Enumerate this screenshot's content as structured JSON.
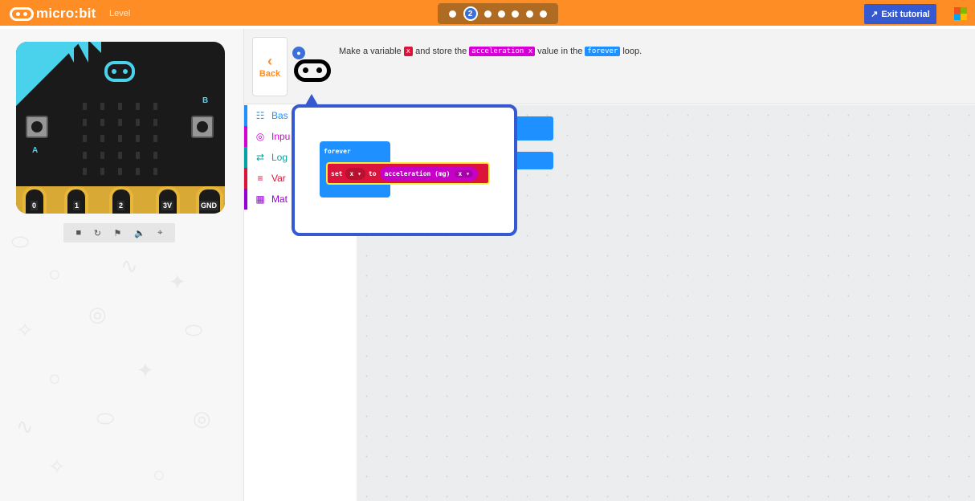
{
  "topbar": {
    "brand": "micro:bit",
    "level": "Level",
    "current_step": "2",
    "exit_label": "Exit tutorial",
    "colors": {
      "bar": "#ff8d26",
      "exit": "#3459d1"
    }
  },
  "simulator": {
    "button_a": "A",
    "button_b": "B",
    "pins": [
      "0",
      "1",
      "2",
      "3V",
      "GND"
    ],
    "toolbar_icons": [
      "stop-icon",
      "restart-icon",
      "slow-motion-icon",
      "mute-icon",
      "fullscreen-icon"
    ]
  },
  "tutorial": {
    "back_label": "Back",
    "hint_icon": "lightbulb-icon",
    "instruction": {
      "part1": "Make a variable",
      "kw1": "x",
      "part2": "and store the",
      "kw2": "acceleration x",
      "part3": "value in the",
      "kw3": "forever",
      "part4": "loop."
    }
  },
  "toolbox": {
    "categories": [
      {
        "label": "Bas",
        "icon": "grid-icon",
        "color": "#1e90ff"
      },
      {
        "label": "Inpu",
        "icon": "target-icon",
        "color": "#d400d4"
      },
      {
        "label": "Log",
        "icon": "shuffle-icon",
        "color": "#00a4a6"
      },
      {
        "label": "Var",
        "icon": "list-icon",
        "color": "#dc143c"
      },
      {
        "label": "Mat",
        "icon": "calculator-icon",
        "color": "#9400d3"
      }
    ]
  },
  "hint_blocks": {
    "forever": "forever",
    "set": "set",
    "var": "x ▾",
    "to": "to",
    "accel": "acceleration (mg)",
    "axis": "x ▾"
  }
}
